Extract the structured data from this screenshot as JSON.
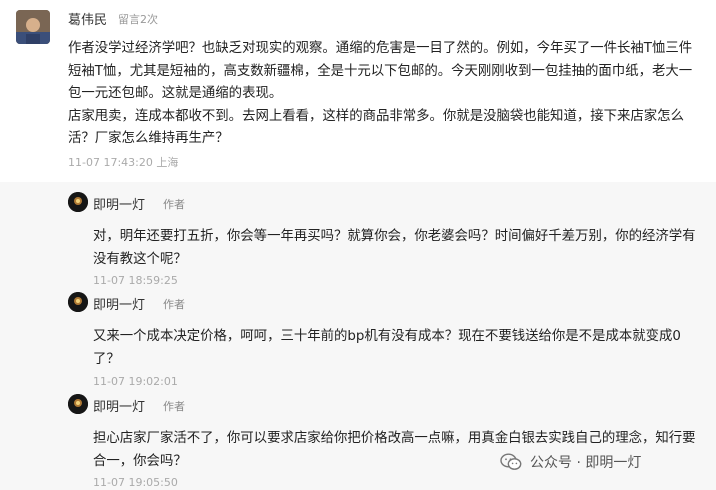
{
  "comment": {
    "author": "葛伟民",
    "reply_count": "留言2次",
    "paragraph_1": "作者没学过经济学吧？也缺乏对现实的观察。通缩的危害是一目了然的。例如，今年买了一件长袖T恤三件短袖T恤，尤其是短袖的，高支数新疆棉，全是十元以下包邮的。今天刚刚收到一包挂抽的面巾纸，老大一包一元还包邮。这就是通缩的表现。",
    "paragraph_2": "店家甩卖，连成本都收不到。去网上看看，这样的商品非常多。你就是没脑袋也能知道，接下来店家怎么活？厂家怎么维持再生产？",
    "time": "11-07 17:43:20 上海"
  },
  "replies": [
    {
      "author": "即明一灯",
      "badge": "作者",
      "text": "对，明年还要打五折，你会等一年再买吗？就算你会，你老婆会吗？时间偏好千差万别，你的经济学有没有教这个呢？",
      "time": "11-07 18:59:25"
    },
    {
      "author": "即明一灯",
      "badge": "作者",
      "text": "又来一个成本决定价格，呵呵，三十年前的bp机有没有成本？现在不要钱送给你是不是成本就变成0了？",
      "time": "11-07 19:02:01"
    },
    {
      "author": "即明一灯",
      "badge": "作者",
      "text": "担心店家厂家活不了，你可以要求店家给你把价格改高一点嘛，用真金白银去实践自己的理念，知行要合一，你会吗？",
      "time": "11-07 19:05:50"
    }
  ],
  "watermark": {
    "text": "公众号 · 即明一灯",
    "icon": "wechat-icon"
  }
}
